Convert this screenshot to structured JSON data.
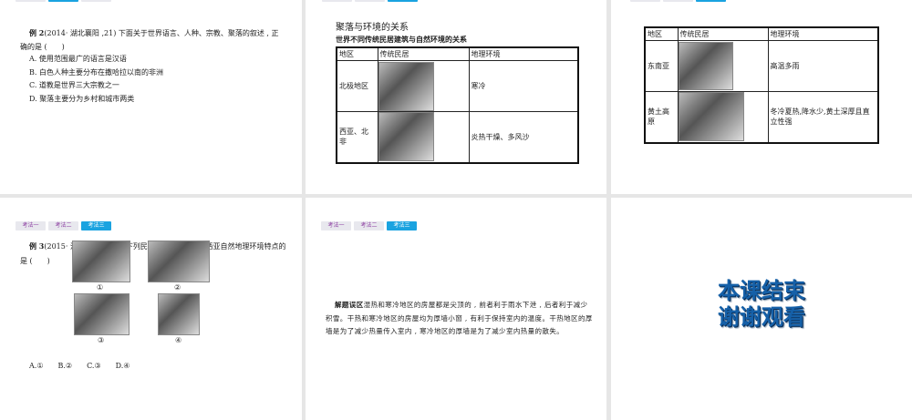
{
  "tabs": [
    "考法一",
    "考法二",
    "考法三"
  ],
  "slide1": {
    "title": "例 2",
    "source": "(2014· 湖北襄阳 ,21) 下面关于世界语言、人种、宗教、聚落的叙述 , 正确的是 (　　)",
    "options": [
      "A. 使用范围最广的语言是汉语",
      "B. 白色人种主要分布在撒哈拉以南的非洲",
      "C. 道教是世界三大宗教之一",
      "D. 聚落主要分为乡村和城市两类"
    ]
  },
  "slide2": {
    "heading": "聚落与环境的关系",
    "subheading": "世界不同传统民居建筑与自然环境的关系",
    "headers": [
      "地区",
      "传统民居",
      "地理环境"
    ],
    "rows": [
      {
        "region": "北极地区",
        "env": "寒冷"
      },
      {
        "region": "西亚、北非",
        "env": "炎热干燥、多风沙"
      }
    ]
  },
  "slide3": {
    "headers": [
      "地区",
      "传统民居",
      "地理环境"
    ],
    "rows": [
      {
        "region": "东南亚",
        "env": "高温多雨"
      },
      {
        "region": "黄土高原",
        "env": "冬冷夏热,降水少,黄土深厚且直立性强"
      }
    ]
  },
  "slide4": {
    "title": "例 3",
    "source": "(2015· 江苏连云港 ,25) 下列民居建筑中 , 能反映西亚自然地理环境特点的是 (　　)",
    "captions": [
      "①",
      "②",
      "③",
      "④"
    ],
    "options": "A.①　　B.②　　C.③　　D.④"
  },
  "slide5": {
    "label": "解题误区",
    "text": "湿热和寒冷地区的房屋都是尖顶的 , 前者利于雨水下泄 , 后者利于减少积雪。干热和寒冷地区的房屋均为厚墙小窗 , 有利于保持室内的温度。干热地区的厚墙是为了减少热量传入室内 , 寒冷地区的厚墙是为了减少室内热量的散失。"
  },
  "slide6": {
    "line1": "本课结束",
    "line2": "谢谢观看"
  }
}
